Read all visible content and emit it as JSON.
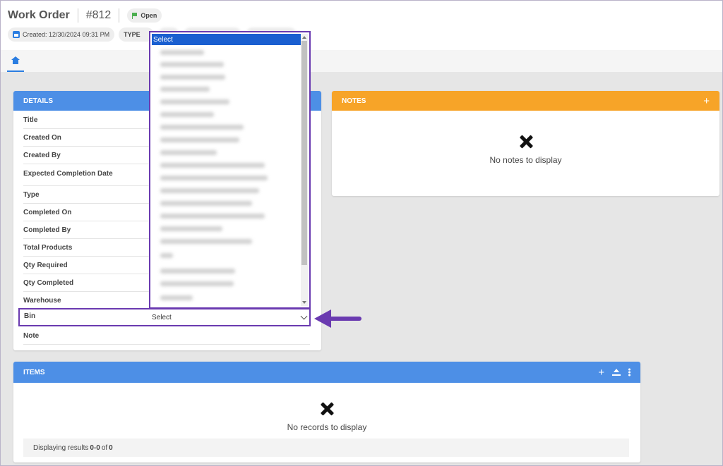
{
  "header": {
    "title": "Work Order",
    "number": "#812",
    "status": "Open",
    "created": "Created: 12/30/2024 09:31 PM",
    "type_label": "TYPE"
  },
  "details": {
    "heading": "DETAILS",
    "rows": [
      "Title",
      "Created On",
      "Created By",
      "Expected Completion Date",
      "Type",
      "Completed On",
      "Completed By",
      "Total Products",
      "Qty Required",
      "Qty Completed",
      "Warehouse"
    ],
    "bin_label": "Bin",
    "bin_value": "Select",
    "note_label": "Note"
  },
  "dropdown": {
    "selected_option": "Select"
  },
  "notes": {
    "heading": "NOTES",
    "empty_text": "No notes to display"
  },
  "items": {
    "heading": "ITEMS",
    "empty_text": "No records to display",
    "results_prefix": "Displaying results",
    "results_range": "0-0",
    "results_of": "of",
    "results_total": "0"
  },
  "colors": {
    "details_header": "#4d8fe6",
    "notes_header": "#f7a428",
    "highlight": "#6a3ab0",
    "selected_option": "#1a5fd0"
  }
}
